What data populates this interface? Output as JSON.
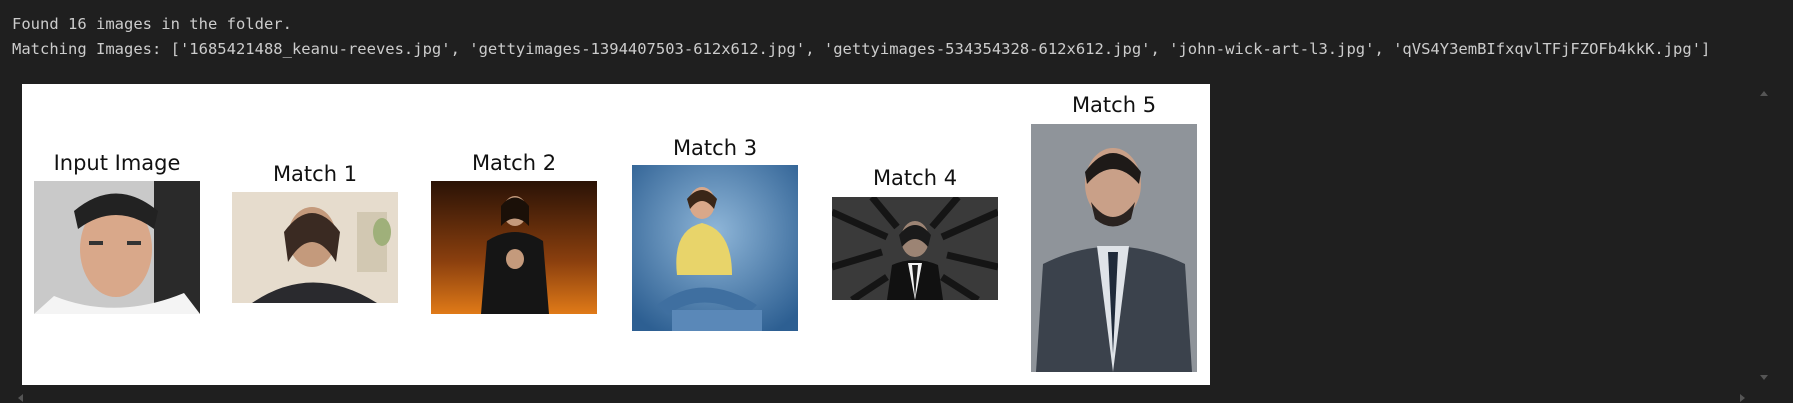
{
  "output": {
    "line1": "Found 16 images in the folder.",
    "line2": "Matching Images: ['1685421488_keanu-reeves.jpg', 'gettyimages-1394407503-612x612.jpg', 'gettyimages-534354328-612x612.jpg', 'john-wick-art-l3.jpg', 'qVS4Y3emBIfxqvlTFjFZOFb4kkK.jpg']"
  },
  "figure": {
    "panels": [
      {
        "title": "Input Image"
      },
      {
        "title": "Match 1"
      },
      {
        "title": "Match 2"
      },
      {
        "title": "Match 3"
      },
      {
        "title": "Match 4"
      },
      {
        "title": "Match 5"
      }
    ]
  },
  "colors": {
    "background": "#1f1f1f",
    "text": "#cccccc",
    "figure_bg": "#ffffff"
  }
}
